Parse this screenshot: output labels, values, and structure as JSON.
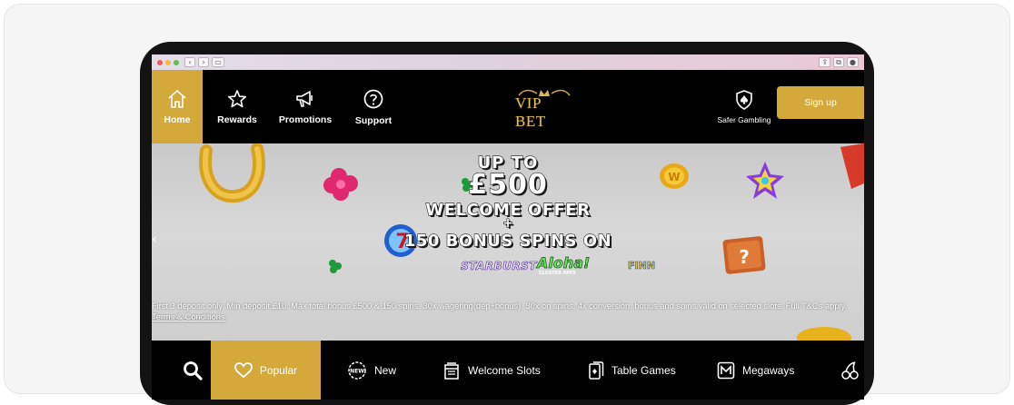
{
  "nav": {
    "home": "Home",
    "rewards": "Rewards",
    "promotions": "Promotions",
    "support": "Support",
    "logo": "VIP BET",
    "safer_gambling": "Safer Gambling",
    "signup": "Sign up"
  },
  "banner": {
    "line1": "UP TO",
    "line2": "£500",
    "line3": "WELCOME OFFER",
    "line4": "+",
    "line5": "150 BONUS SPINS ON",
    "game1": "STARBURST",
    "game2": "Aloha!",
    "game2_sub": "CLUSTER PAYS",
    "game3": "FINN",
    "terms_text": "First 3 deposit only. Min deposit £10. Max total bonus £500 & 150 spins. 30x wagering(dep+bonus). 30x on spins, 4x conversion, bonus and spins valid on selected slots. Full T&Cs apply. ",
    "terms_link": "Terms & Conditions"
  },
  "categories": {
    "popular": "Popular",
    "new": "New",
    "new_badge": "NEW",
    "welcome_slots": "Welcome Slots",
    "table_games": "Table Games",
    "megaways": "Megaways"
  },
  "colors": {
    "gold": "#d4a83a",
    "black": "#000000",
    "banner_bg": "#d2d2d2"
  }
}
